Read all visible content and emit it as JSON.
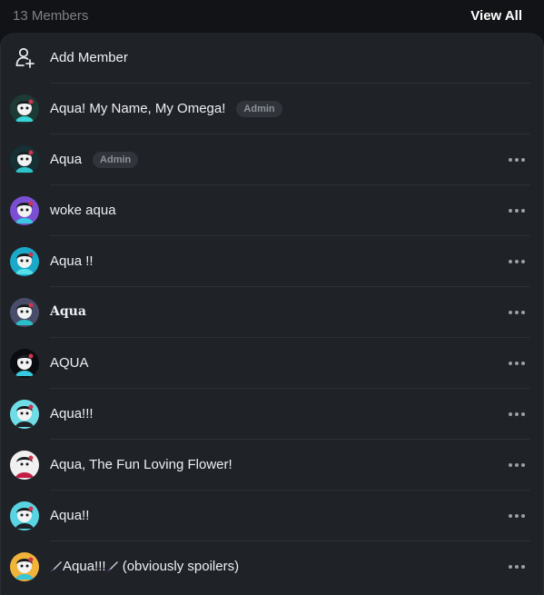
{
  "header": {
    "member_count": "13 Members",
    "view_all": "View All"
  },
  "add_member": {
    "label": "Add Member",
    "icon": "add-user-icon"
  },
  "members": [
    {
      "name": "Aqua! My Name, My Omega!",
      "badge": "Admin",
      "more": false,
      "bg": "#1d3a35",
      "accent": "#37d4d8"
    },
    {
      "name": "Aqua",
      "badge": "Admin",
      "more": true,
      "bg": "#163033",
      "accent": "#2fc3c9"
    },
    {
      "name": "woke aqua",
      "badge": "",
      "more": true,
      "bg": "#7b4fd2",
      "accent": "#39c8e0"
    },
    {
      "name": "Aqua !!",
      "badge": "",
      "more": true,
      "bg": "#1aa9c9",
      "accent": "#55e0ea"
    },
    {
      "name": "𝐀𝐪𝐮𝐚",
      "badge": "",
      "more": true,
      "bg": "#4a4d6a",
      "accent": "#2ac0c9"
    },
    {
      "name": "AQUA",
      "badge": "",
      "more": true,
      "bg": "#0b0c0f",
      "accent": "#38c9df"
    },
    {
      "name": "Aqua!!!",
      "badge": "",
      "more": true,
      "bg": "#6fdde6",
      "accent": "#1e2327"
    },
    {
      "name": "Aqua, The Fun Loving Flower!",
      "badge": "",
      "more": true,
      "bg": "#f0f0f0",
      "accent": "#c21e45"
    },
    {
      "name": "Aqua!!",
      "badge": "",
      "more": true,
      "bg": "#58d4e2",
      "accent": "#1d2329"
    },
    {
      "name_prefix": "Aqua!!!",
      "name_suffix": " (obviously spoilers)",
      "badge": "",
      "more": true,
      "bg": "#f1b43a",
      "accent": "#38c5d8"
    }
  ]
}
